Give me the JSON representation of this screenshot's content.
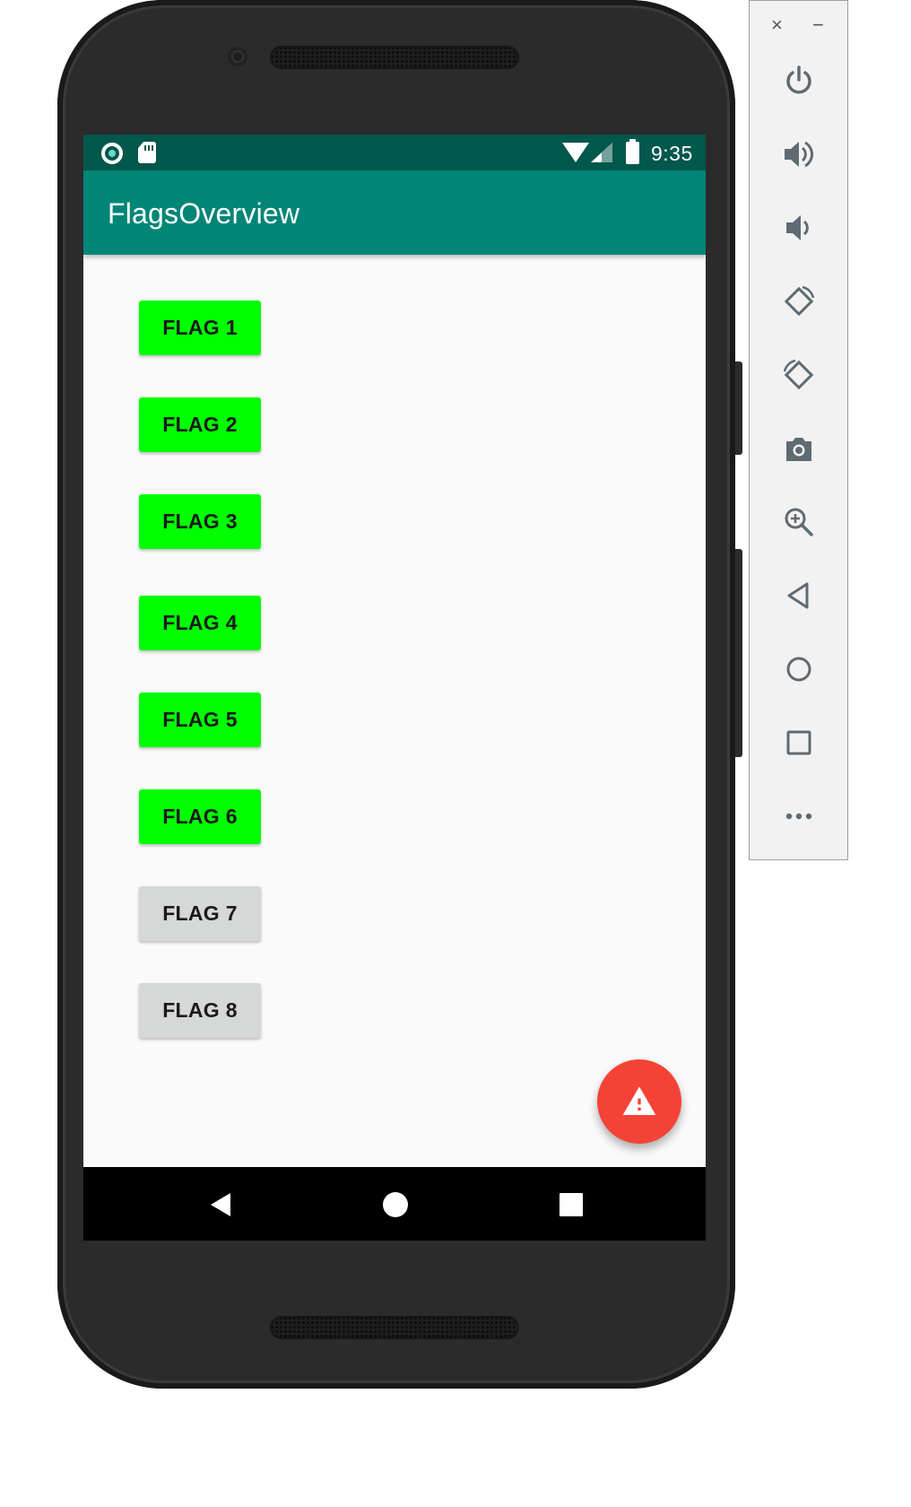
{
  "status_bar": {
    "time": "9:35"
  },
  "app_bar": {
    "title": "FlagsOverview"
  },
  "flags": [
    {
      "label": "FLAG 1",
      "state": "on"
    },
    {
      "label": "FLAG 2",
      "state": "on"
    },
    {
      "label": "FLAG 3",
      "state": "on"
    },
    {
      "label": "FLAG 4",
      "state": "on"
    },
    {
      "label": "FLAG 5",
      "state": "on"
    },
    {
      "label": "FLAG 6",
      "state": "on"
    },
    {
      "label": "FLAG 7",
      "state": "off"
    },
    {
      "label": "FLAG 8",
      "state": "off"
    }
  ],
  "colors": {
    "status_bar": "#00574b",
    "app_bar": "#008577",
    "flag_on": "#00ff00",
    "flag_off": "#d6d7d7",
    "fab": "#f44336"
  },
  "fab": {
    "icon": "warning-icon"
  },
  "nav_bar": {
    "icons": [
      "back-icon",
      "home-icon",
      "recents-icon"
    ]
  },
  "emulator_toolbar": {
    "close_glyph": "×",
    "minimize_glyph": "−",
    "icons": [
      "power-icon",
      "volume-up-icon",
      "volume-down-icon",
      "rotate-left-icon",
      "rotate-right-icon",
      "camera-icon",
      "zoom-icon",
      "back-icon",
      "home-icon",
      "overview-icon",
      "more-icon"
    ]
  }
}
